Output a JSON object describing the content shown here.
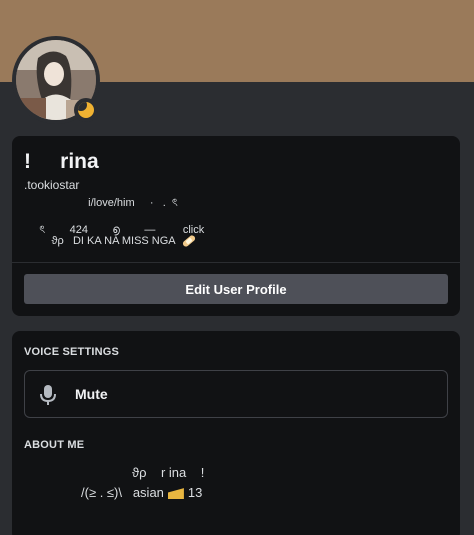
{
  "profile": {
    "display_name": "!     rina",
    "username": ".tookiostar",
    "pronouns_line": "                     i/love/him     ·   .  ৎ",
    "status_line1": "     ৎ        424        ൭        —         click",
    "status_line2": "         ϑρ   DI KA NA MISS NGA",
    "edit_button_label": "Edit User Profile"
  },
  "voice_settings": {
    "heading": "VOICE SETTINGS",
    "mute_label": "Mute"
  },
  "about_me": {
    "heading": "ABOUT ME",
    "line1": "ϑρ    r ina    !",
    "line2_left": "/(≥ . ≤)\\   asian",
    "line2_right": "13"
  },
  "colors": {
    "banner": "#9a7a5a",
    "card": "#111214",
    "background": "#2b2d31",
    "button": "#4e5058",
    "status_idle": "#f0b232"
  },
  "icons": {
    "microphone": "microphone-icon",
    "idle_status": "moon-status-icon",
    "bandage": "adhesive-bandage-emoji",
    "cheese": "cheese-emoji"
  }
}
